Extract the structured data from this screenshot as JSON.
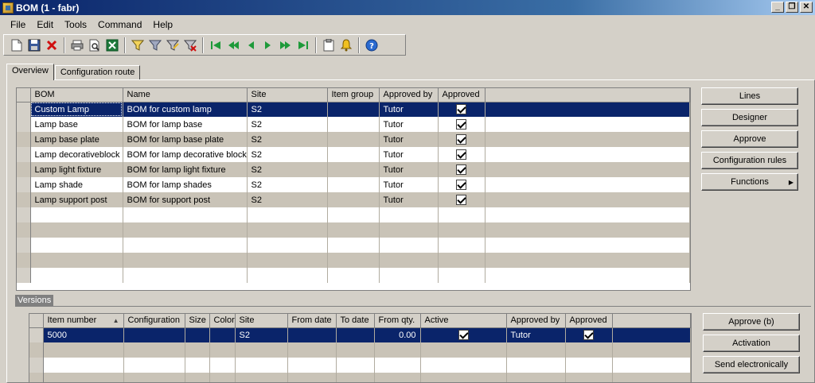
{
  "window": {
    "title": "BOM (1 - fabr)"
  },
  "menu": [
    {
      "label": "File"
    },
    {
      "label": "Edit"
    },
    {
      "label": "Tools"
    },
    {
      "label": "Command"
    },
    {
      "label": "Help"
    }
  ],
  "tabs": [
    {
      "label": "Overview"
    },
    {
      "label": "Configuration route"
    }
  ],
  "bom_grid": {
    "columns": [
      "BOM",
      "Name",
      "Site",
      "Item group",
      "Approved by",
      "Approved"
    ],
    "rows": [
      {
        "bom": "Custom Lamp",
        "name": "BOM for custom lamp",
        "site": "S2",
        "item_group": "",
        "approved_by": "Tutor",
        "approved": true
      },
      {
        "bom": "Lamp base",
        "name": "BOM for lamp base",
        "site": "S2",
        "item_group": "",
        "approved_by": "Tutor",
        "approved": true
      },
      {
        "bom": "Lamp base plate",
        "name": "BOM for lamp base plate",
        "site": "S2",
        "item_group": "",
        "approved_by": "Tutor",
        "approved": true
      },
      {
        "bom": "Lamp decorativeblock",
        "name": "BOM for lamp decorative block",
        "site": "S2",
        "item_group": "",
        "approved_by": "Tutor",
        "approved": true
      },
      {
        "bom": "Lamp light fixture",
        "name": "BOM for lamp light fixture",
        "site": "S2",
        "item_group": "",
        "approved_by": "Tutor",
        "approved": true
      },
      {
        "bom": "Lamp shade",
        "name": "BOM for lamp shades",
        "site": "S2",
        "item_group": "",
        "approved_by": "Tutor",
        "approved": true
      },
      {
        "bom": "Lamp support post",
        "name": "BOM for support post",
        "site": "S2",
        "item_group": "",
        "approved_by": "Tutor",
        "approved": true
      }
    ]
  },
  "bom_buttons": {
    "lines": "Lines",
    "designer": "Designer",
    "approve": "Approve",
    "configuration_rules": "Configuration rules",
    "functions": "Functions"
  },
  "versions": {
    "label": "Versions",
    "columns": [
      "Item number",
      "Configuration",
      "Size",
      "Color",
      "Site",
      "From date",
      "To date",
      "From qty.",
      "Active",
      "Approved by",
      "Approved"
    ],
    "rows": [
      {
        "item_number": "5000",
        "configuration": "",
        "size": "",
        "color": "",
        "site": "S2",
        "from_date": "",
        "to_date": "",
        "from_qty": "0.00",
        "active": true,
        "approved_by": "Tutor",
        "approved": true
      }
    ],
    "buttons": {
      "approve": "Approve (b)",
      "activation": "Activation",
      "send_electronically": "Send electronically"
    }
  },
  "colors": {
    "selected_row": "#0a246a",
    "alt_row": "#c9c3b7",
    "window_bg": "#d4d0c8"
  }
}
